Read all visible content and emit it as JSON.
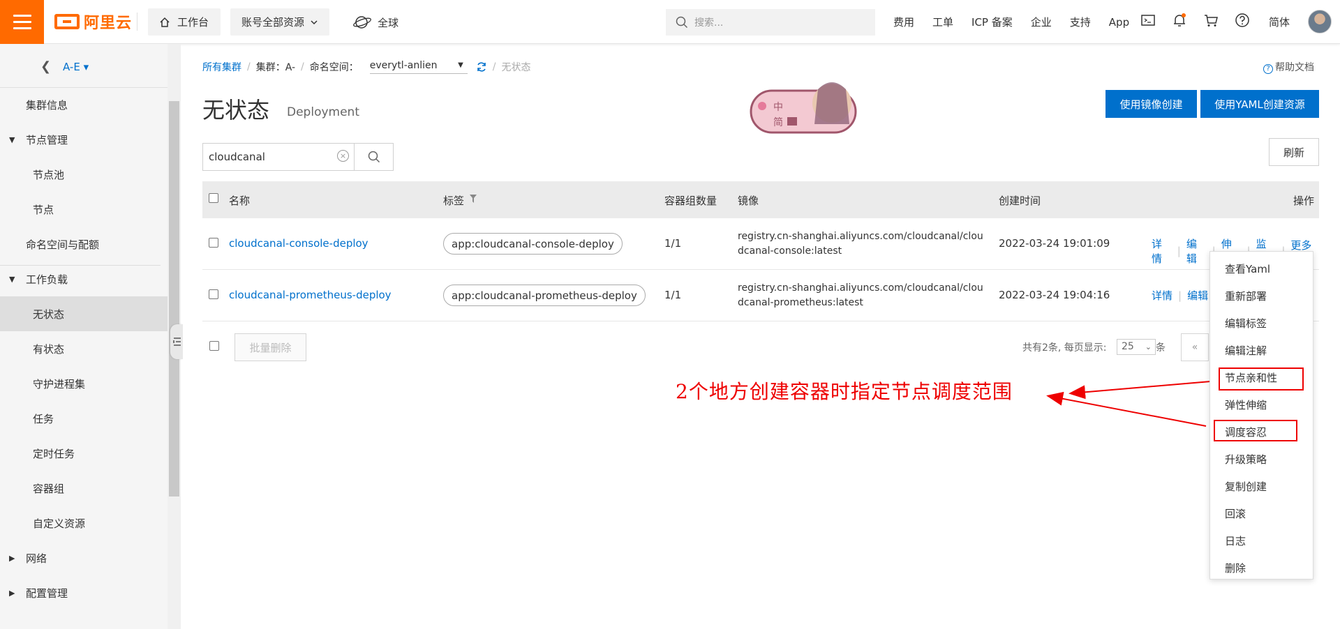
{
  "topbar": {
    "logo_text": "阿里云",
    "workbench_label": "工作台",
    "resource_label": "账号全部资源",
    "region_label": "全球",
    "search_placeholder": "搜索...",
    "links": [
      "费用",
      "工单",
      "ICP 备案",
      "企业",
      "支持",
      "App"
    ],
    "icons": [
      "terminal-icon",
      "bell-icon",
      "cart-icon",
      "help-icon"
    ],
    "language": "简体",
    "accent_color": "#ff6a00"
  },
  "sidebar": {
    "cluster_name": "A-E",
    "items": [
      {
        "label": "集群信息",
        "level": 1
      },
      {
        "label": "节点管理",
        "level": 0,
        "expanded": true
      },
      {
        "label": "节点池",
        "level": 2
      },
      {
        "label": "节点",
        "level": 2
      },
      {
        "label": "命名空间与配额",
        "level": 1
      },
      {
        "label": "工作负载",
        "level": 0,
        "expanded": true
      },
      {
        "label": "无状态",
        "level": 2,
        "active": true
      },
      {
        "label": "有状态",
        "level": 2
      },
      {
        "label": "守护进程集",
        "level": 2
      },
      {
        "label": "任务",
        "level": 2
      },
      {
        "label": "定时任务",
        "level": 2
      },
      {
        "label": "容器组",
        "level": 2
      },
      {
        "label": "自定义资源",
        "level": 2
      },
      {
        "label": "网络",
        "level": 0,
        "expanded": false
      },
      {
        "label": "配置管理",
        "level": 0,
        "expanded": false
      }
    ]
  },
  "breadcrumb": {
    "all_clusters": "所有集群",
    "cluster": "集群：A-",
    "namespace_label": "命名空间：",
    "namespace_value": "everytl-anlien",
    "current": "无状态"
  },
  "help_label": "帮助文档",
  "page": {
    "title": "无状态",
    "subtitle": "Deployment"
  },
  "buttons": {
    "create_from_image": "使用镜像创建",
    "create_from_yaml": "使用YAML创建资源",
    "refresh": "刷新",
    "batch_delete": "批量删除"
  },
  "search": {
    "value": "cloudcanal"
  },
  "table": {
    "columns": [
      "名称",
      "标签",
      "容器组数量",
      "镜像",
      "创建时间",
      "操作"
    ],
    "rows": [
      {
        "name": "cloudcanal-console-deploy",
        "tag": "app:cloudcanal-console-deploy",
        "pods": "1/1",
        "image": "registry.cn-shanghai.aliyuncs.com/cloudcanal/cloudcanal-console:latest",
        "created": "2022-03-24 19:01:09"
      },
      {
        "name": "cloudcanal-prometheus-deploy",
        "tag": "app:cloudcanal-prometheus-deploy",
        "pods": "1/1",
        "image": "registry.cn-shanghai.aliyuncs.com/cloudcanal/cloudcanal-prometheus:latest",
        "created": "2022-03-24 19:04:16"
      }
    ],
    "row_ops": [
      "详情",
      "编辑",
      "伸缩",
      "监控",
      "更多"
    ]
  },
  "pager": {
    "summary": "共有2条, 每页显示:",
    "page_size": "25",
    "unit": "条",
    "prev": "«"
  },
  "annotation": "2个地方创建容器时指定节点调度范围",
  "dropdown": {
    "items": [
      "查看Yaml",
      "重新部署",
      "编辑标签",
      "编辑注解",
      "节点亲和性",
      "弹性伸缩",
      "调度容忍",
      "升级策略",
      "复制创建",
      "回滚",
      "日志",
      "删除"
    ]
  },
  "sticker": {
    "line1": "中",
    "line2": "简"
  }
}
